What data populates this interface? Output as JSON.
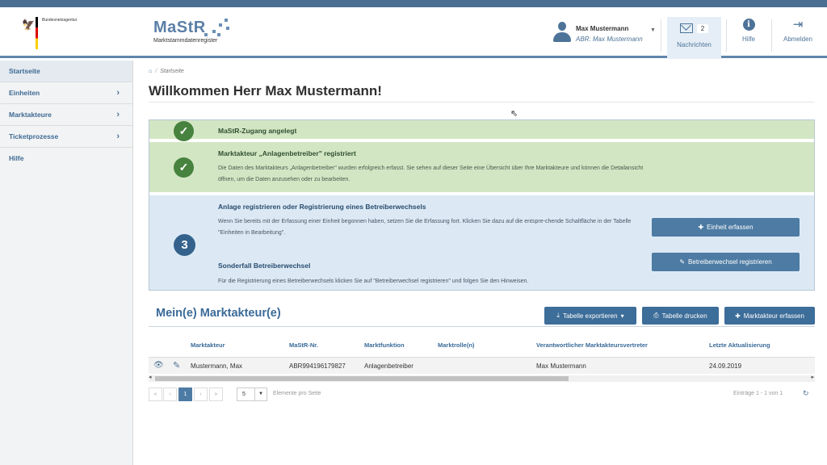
{
  "header": {
    "agency_name": "Bundesnetzagentur",
    "logo_title": "MaStR",
    "logo_subtitle": "Marktstammdatenregister",
    "user_name": "Max Mustermann",
    "user_role": "ABR: Max Mustermann",
    "messages_count": "2",
    "messages_label": "Nachrichten",
    "help_label": "Hilfe",
    "logout_label": "Abmelden"
  },
  "sidebar": {
    "items": [
      {
        "label": "Startseite"
      },
      {
        "label": "Einheiten"
      },
      {
        "label": "Marktakteure"
      },
      {
        "label": "Ticketprozesse"
      },
      {
        "label": "Hilfe"
      }
    ]
  },
  "main": {
    "breadcrumb": "Startseite",
    "title": "Willkommen Herr Max Mustermann!",
    "steps": [
      {
        "title": "MaStR-Zugang angelegt"
      },
      {
        "title": "Marktakteur „Anlagenbetreiber\" registriert",
        "text": "Die Daten des Marktakteurs „Anlagenbetreiber\" wurden erfolgreich erfasst. Sie sehen auf dieser Seite eine Übersicht über Ihre Marktakteure und können die Detailansicht öffnen, um die Daten anzusehen oder zu bearbeiten."
      },
      {
        "number": "3",
        "title": "Anlage registrieren oder Registrierung eines Betreiberwechsels",
        "text": "Wenn Sie bereits mit der Erfassung einer Einheit begonnen haben, setzen Sie die Erfassung fort. Klicken Sie dazu auf die entspre-chende Schaltfläche in der Tabelle \"Einheiten in Bearbeitung\".",
        "button": "Einheit erfassen",
        "subtitle": "Sonderfall Betreiberwechsel",
        "subtext": "Für die Registrierung eines Betreiberwechsels klicken Sie auf \"Betreiberwechsel registrieren\" und folgen Sie den Hinweisen.",
        "button2": "Betreiberwechsel registrieren"
      }
    ],
    "section_title": "Mein(e) Marktakteur(e)",
    "export_label": "Tabelle exportieren",
    "print_label": "Tabelle drucken",
    "add_label": "Marktakteur erfassen",
    "table": {
      "columns": [
        "Marktakteur",
        "MaStR-Nr.",
        "Marktfunktion",
        "Marktrolle(n)",
        "Verantwortlicher Marktakteursvertreter",
        "Letzte Aktualisierung"
      ],
      "rows": [
        {
          "name": "Mustermann, Max",
          "nr": "ABR994196179827",
          "function": "Anlagenbetreiber",
          "roles": "",
          "rep": "Max Mustermann",
          "updated": "24.09.2019"
        }
      ]
    },
    "pager": {
      "first": "«",
      "prev": "‹",
      "current": "1",
      "next": "›",
      "last": "»",
      "page_size": "5",
      "page_size_label": "Elemente pro Seite",
      "count_label": "Einträge 1 - 1 von 1"
    }
  },
  "colors": {
    "accent": "#4d7ba3",
    "success": "#47823f",
    "success_bg": "#d3e6c4",
    "info_bg": "#dce9f5"
  }
}
